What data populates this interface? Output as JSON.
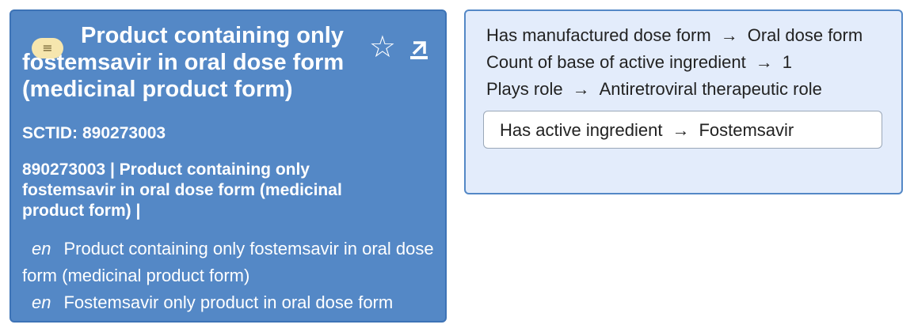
{
  "concept": {
    "title": "Product containing only fostemsavir in oral dose form (medicinal product form)",
    "menu_icon": "hamburger-icon",
    "star_icon": "star-outline-icon",
    "export_icon": "export-icon",
    "sctid_label": "SCTID:",
    "sctid": "890273003",
    "fsn_line": "890273003 | Product containing only fostemsavir in oral dose form (medicinal product form) |",
    "descriptions": [
      {
        "lang": "en",
        "text": "Product containing only fostemsavir in oral dose form (medicinal product form)"
      },
      {
        "lang": "en",
        "text": "Fostemsavir only product in oral dose form"
      }
    ]
  },
  "attributes": {
    "items": [
      {
        "name": "Has manufactured dose form",
        "arrow": "→",
        "value": "Oral dose form"
      },
      {
        "name": "Count of base of active ingredient",
        "arrow": "→",
        "value": "1"
      },
      {
        "name": "Plays role",
        "arrow": "→",
        "value": "Antiretroviral therapeutic role"
      }
    ],
    "group": {
      "name": "Has active ingredient",
      "arrow": "→",
      "value": "Fostemsavir"
    }
  }
}
